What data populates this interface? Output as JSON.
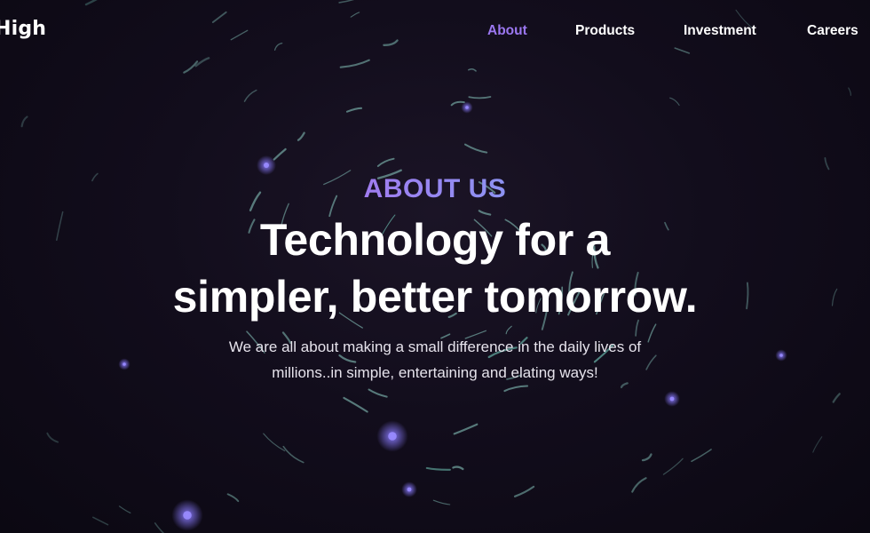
{
  "brand": {
    "logo_text": "High"
  },
  "nav": {
    "items": [
      {
        "label": "About",
        "active": true
      },
      {
        "label": "Products",
        "active": false
      },
      {
        "label": "Investment",
        "active": false
      },
      {
        "label": "Careers",
        "active": false
      }
    ]
  },
  "hero": {
    "eyebrow": "ABOUT US",
    "headline_line1": "Technology for a",
    "headline_line2": "simpler, better tomorrow.",
    "subtext_line1": "We are all about making a small difference in the daily lives of",
    "subtext_line2": "millions..in simple, entertaining and elating ways!"
  },
  "colors": {
    "background": "#0e0a16",
    "accent": "#9b77f0",
    "text": "#ffffff",
    "streak": "#8fd3c8"
  }
}
